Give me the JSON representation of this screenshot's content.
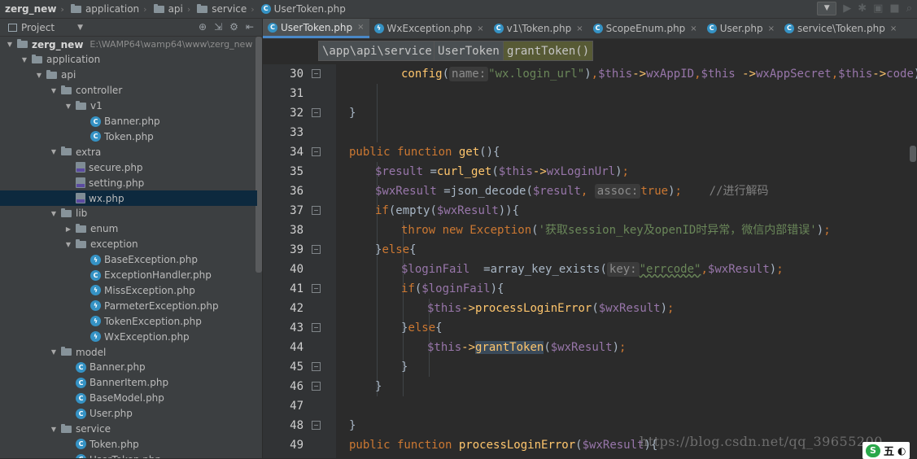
{
  "navbar": {
    "crumbs": [
      "zerg_new",
      "application",
      "api",
      "service",
      "UserToken.php"
    ]
  },
  "project": {
    "title": "Project",
    "tree": [
      {
        "label": "zerg_new",
        "path": "E:\\WAMP64\\wamp64\\www\\zerg_new",
        "indent": 0,
        "type": "folder",
        "expanded": true,
        "bold": true
      },
      {
        "label": "application",
        "indent": 1,
        "type": "folder",
        "expanded": true
      },
      {
        "label": "api",
        "indent": 2,
        "type": "folder",
        "expanded": true
      },
      {
        "label": "controller",
        "indent": 3,
        "type": "folder",
        "expanded": true
      },
      {
        "label": "v1",
        "indent": 4,
        "type": "folder",
        "expanded": true
      },
      {
        "label": "Banner.php",
        "indent": 5,
        "type": "class"
      },
      {
        "label": "Token.php",
        "indent": 5,
        "type": "class"
      },
      {
        "label": "extra",
        "indent": 3,
        "type": "folder",
        "expanded": true
      },
      {
        "label": "secure.php",
        "indent": 4,
        "type": "php"
      },
      {
        "label": "setting.php",
        "indent": 4,
        "type": "php"
      },
      {
        "label": "wx.php",
        "indent": 4,
        "type": "php",
        "selected": true
      },
      {
        "label": "lib",
        "indent": 3,
        "type": "folder",
        "expanded": true
      },
      {
        "label": "enum",
        "indent": 4,
        "type": "folder",
        "expanded": false
      },
      {
        "label": "exception",
        "indent": 4,
        "type": "folder",
        "expanded": true
      },
      {
        "label": "BaseException.php",
        "indent": 5,
        "type": "exc"
      },
      {
        "label": "ExceptionHandler.php",
        "indent": 5,
        "type": "class"
      },
      {
        "label": "MissException.php",
        "indent": 5,
        "type": "exc"
      },
      {
        "label": "ParmeterException.php",
        "indent": 5,
        "type": "exc"
      },
      {
        "label": "TokenException.php",
        "indent": 5,
        "type": "exc"
      },
      {
        "label": "WxException.php",
        "indent": 5,
        "type": "exc"
      },
      {
        "label": "model",
        "indent": 3,
        "type": "folder",
        "expanded": true
      },
      {
        "label": "Banner.php",
        "indent": 4,
        "type": "class"
      },
      {
        "label": "BannerItem.php",
        "indent": 4,
        "type": "class"
      },
      {
        "label": "BaseModel.php",
        "indent": 4,
        "type": "class"
      },
      {
        "label": "User.php",
        "indent": 4,
        "type": "class"
      },
      {
        "label": "service",
        "indent": 3,
        "type": "folder",
        "expanded": true
      },
      {
        "label": "Token.php",
        "indent": 4,
        "type": "class"
      },
      {
        "label": "UserToken.php",
        "indent": 4,
        "type": "class"
      }
    ]
  },
  "tabs": [
    {
      "label": "UserToken.php",
      "icon": "C",
      "active": true
    },
    {
      "label": "WxException.php",
      "icon": "E"
    },
    {
      "label": "v1\\Token.php",
      "icon": "C"
    },
    {
      "label": "ScopeEnum.php",
      "icon": "C"
    },
    {
      "label": "User.php",
      "icon": "C"
    },
    {
      "label": "service\\Token.php",
      "icon": "C"
    }
  ],
  "breadcrumb": {
    "namespace": "\\app\\api\\service",
    "class": "UserToken",
    "method": "grantToken()"
  },
  "editor": {
    "line_numbers": [
      "30",
      "31",
      "32",
      "33",
      "34",
      "35",
      "36",
      "37",
      "38",
      "39",
      "40",
      "41",
      "42",
      "43",
      "44",
      "45",
      "46",
      "47",
      "48",
      "49"
    ],
    "hints": {
      "name": "name:",
      "assoc": "assoc:",
      "key": "key:"
    }
  },
  "watermark": "https://blog.csdn.net/qq_39655200",
  "ime": {
    "logo": "S",
    "mode": "五"
  }
}
